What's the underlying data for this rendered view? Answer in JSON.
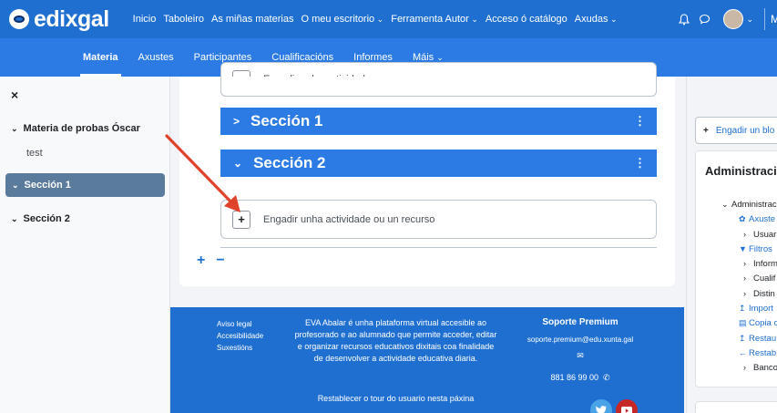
{
  "brand": {
    "name": "edixgal"
  },
  "topnav": [
    "Inicio",
    "Taboleiro",
    "As miñas materias",
    "O meu escritorio",
    "Ferramenta Autor",
    "Acceso ó catálogo",
    "Axudas"
  ],
  "topnav_dropdowns": [
    false,
    false,
    false,
    true,
    true,
    false,
    true
  ],
  "user": {
    "initial": "M"
  },
  "subnav": {
    "tabs": [
      "Materia",
      "Axustes",
      "Participantes",
      "Cualificacións",
      "Informes",
      "Máis"
    ],
    "active": "Materia"
  },
  "drawer": {
    "close_label": "×",
    "course": "Materia de probas Óscar",
    "test": "test",
    "section1": "Sección 1",
    "section2": "Sección 2"
  },
  "main": {
    "add_activity_label": "Engadir unha actividade ou un recurso",
    "section1_title": "Sección 1",
    "section2_title": "Sección 2",
    "plus_label": "+",
    "minus_label": "−"
  },
  "footer": {
    "links": [
      "Aviso legal",
      "Accesibilidade",
      "Suxestións"
    ],
    "description": "EVA Abalar é unha plataforma virtual accesible ao profesorado e ao alumnado que permite acceder, editar e organizar recursos educativos dixitais coa finalidade de desenvolver a actividade educativa diaria.",
    "tour": "Restablecer o tour do usuario nesta páxina",
    "support_title": "Soporte Premium",
    "support_mail": "soporte.premium@edu.xunta.gal",
    "support_phone": "881 86 99 00"
  },
  "right": {
    "add_block": "Engadir un blo",
    "admin_title": "Administración",
    "tree": [
      {
        "label": "Administrac",
        "level": 0,
        "icon": "chevron-down-icon",
        "link": false
      },
      {
        "label": "Axuste",
        "level": 1,
        "icon": "gear-icon",
        "link": true
      },
      {
        "label": "Usuar",
        "level": 2,
        "icon": "chevron-right-icon",
        "link": false
      },
      {
        "label": "Filtros",
        "level": 1,
        "icon": "filter-icon",
        "link": true
      },
      {
        "label": "Inform",
        "level": 2,
        "icon": "chevron-right-icon",
        "link": false
      },
      {
        "label": "Cualif",
        "level": 2,
        "icon": "chevron-right-icon",
        "link": false
      },
      {
        "label": "Distin",
        "level": 2,
        "icon": "chevron-right-icon",
        "link": false
      },
      {
        "label": "Import",
        "level": 1,
        "icon": "import-icon",
        "link": true
      },
      {
        "label": "Copia c",
        "level": 1,
        "icon": "file-icon",
        "link": true
      },
      {
        "label": "Restau",
        "level": 1,
        "icon": "upload-icon",
        "link": true
      },
      {
        "label": "Restab",
        "level": 1,
        "icon": "arrow-left-icon",
        "link": true
      },
      {
        "label": "Banco",
        "level": 2,
        "icon": "chevron-right-icon",
        "link": false
      }
    ]
  },
  "colors": {
    "primary": "#1f6fd1",
    "secondary": "#2c7be5",
    "active_section": "#5b7b9c",
    "arrow": "#e0432c"
  }
}
